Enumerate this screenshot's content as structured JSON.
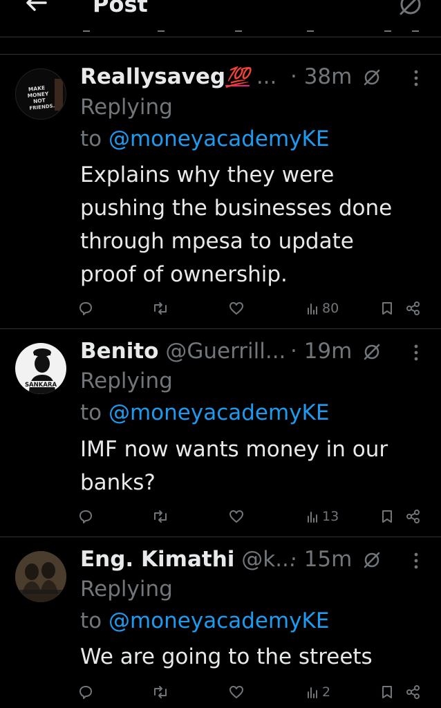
{
  "header": {
    "title": "Post",
    "back_icon": "back-arrow-icon",
    "grok_icon": "grok-icon"
  },
  "tweets": [
    {
      "display_name": "Reallysaveg",
      "emoji": "💯",
      "handle": "...",
      "time": "· 38m",
      "replying": "Replying",
      "to_prefix": "to ",
      "mention": "@moneyacademyKE",
      "text_lines": [
        "Explains why they were",
        "pushing the businesses done",
        "through mpesa to update",
        "proof of ownership."
      ],
      "views": "80",
      "avatar_text": [
        "MAKE",
        "MONEY",
        "NOT",
        "FRIENDS."
      ]
    },
    {
      "display_name": "Benito",
      "handle": "@Guerrill...",
      "time": "· 19m",
      "replying": "Replying",
      "to_prefix": "to ",
      "mention": "@moneyacademyKE",
      "text_lines": [
        "IMF now wants money in our",
        "banks?"
      ],
      "views": "13",
      "avatar_text": [
        "SANKARA"
      ]
    },
    {
      "display_name": "Eng. Kimathi",
      "handle": "@k...",
      "time": "· 15m",
      "replying": "Replying",
      "to_prefix": "to ",
      "mention": "@moneyacademyKE",
      "text_lines": [
        "We are going to the streets"
      ],
      "views": "2",
      "avatar_text": []
    }
  ],
  "colors": {
    "bg": "#000000",
    "text": "#e7e9ea",
    "muted": "#71767b",
    "link": "#1d9bf0",
    "border": "#2f3336"
  }
}
